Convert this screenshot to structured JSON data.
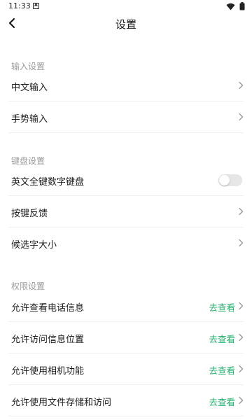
{
  "status_bar": {
    "time": "11:33",
    "notification_badge": "A"
  },
  "header": {
    "title": "设置",
    "back_icon": "chevron-left-icon"
  },
  "sections": [
    {
      "title": "输入设置",
      "items": [
        {
          "label": "中文输入",
          "control": "chevron"
        },
        {
          "label": "手势输入",
          "control": "chevron"
        }
      ]
    },
    {
      "title": "键盘设置",
      "items": [
        {
          "label": "英文全键数字键盘",
          "control": "toggle",
          "toggle_on": false
        },
        {
          "label": "按键反馈",
          "control": "chevron"
        },
        {
          "label": "候选字大小",
          "control": "chevron"
        }
      ]
    },
    {
      "title": "权限设置",
      "items": [
        {
          "label": "允许查看电话信息",
          "action": "去查看",
          "control": "chevron"
        },
        {
          "label": "允许访问信息位置",
          "action": "去查看",
          "control": "chevron"
        },
        {
          "label": "允许使用相机功能",
          "action": "去查看",
          "control": "chevron"
        },
        {
          "label": "允许使用文件存储和访问",
          "action": "去查看",
          "control": "chevron"
        }
      ]
    }
  ],
  "colors": {
    "accent_green": "#23b26d",
    "section_header": "#9a9a9a",
    "divider": "#efefef"
  }
}
